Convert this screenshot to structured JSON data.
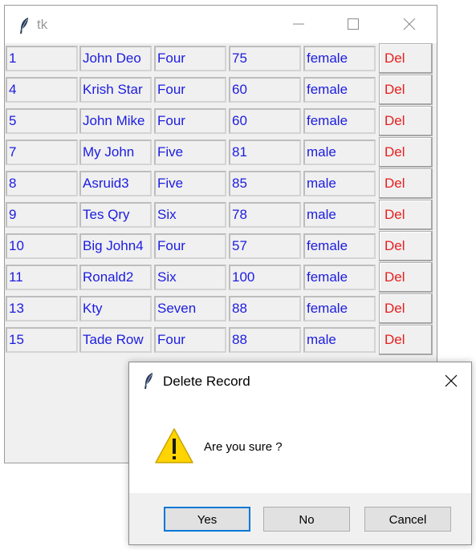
{
  "window": {
    "title": "tk"
  },
  "rows": [
    {
      "id": "1",
      "name": "John Deo",
      "class": "Four",
      "mark": "75",
      "gender": "female",
      "del": "Del"
    },
    {
      "id": "4",
      "name": "Krish Star",
      "class": "Four",
      "mark": "60",
      "gender": "female",
      "del": "Del"
    },
    {
      "id": "5",
      "name": "John Mike",
      "class": "Four",
      "mark": "60",
      "gender": "female",
      "del": "Del"
    },
    {
      "id": "7",
      "name": "My John",
      "class": "Five",
      "mark": "81",
      "gender": "male",
      "del": "Del"
    },
    {
      "id": "8",
      "name": "Asruid3",
      "class": "Five",
      "mark": "85",
      "gender": "male",
      "del": "Del"
    },
    {
      "id": "9",
      "name": "Tes Qry",
      "class": "Six",
      "mark": "78",
      "gender": "male",
      "del": "Del"
    },
    {
      "id": "10",
      "name": "Big John4",
      "class": "Four",
      "mark": "57",
      "gender": "female",
      "del": "Del"
    },
    {
      "id": "11",
      "name": "Ronald2",
      "class": "Six",
      "mark": "100",
      "gender": "female",
      "del": "Del"
    },
    {
      "id": "13",
      "name": "Kty",
      "class": "Seven",
      "mark": "88",
      "gender": "female",
      "del": "Del"
    },
    {
      "id": "15",
      "name": "Tade Row",
      "class": "Four",
      "mark": "88",
      "gender": "male",
      "del": "Del"
    }
  ],
  "dialog": {
    "title": "Delete Record",
    "message": "Are you sure ?",
    "yes_label": "Yes",
    "no_label": "No",
    "cancel_label": "Cancel"
  },
  "colors": {
    "cell_text": "#1c1ce0",
    "del_text": "#e81e1e",
    "default_button_border": "#0078d7",
    "warning_fill": "#ffd400"
  },
  "icons": {
    "app": "feather-icon",
    "minimize": "minimize-icon",
    "maximize": "maximize-icon",
    "close": "close-icon",
    "warning": "warning-icon"
  }
}
